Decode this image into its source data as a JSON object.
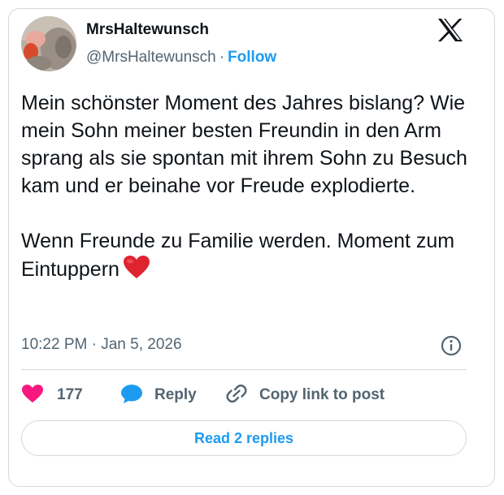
{
  "author": {
    "display_name": "MrsHaltewunsch",
    "handle": "@MrsHaltewunsch",
    "separator": "·",
    "follow_label": "Follow"
  },
  "tweet": {
    "paragraphs": [
      "Mein schönster Moment des Jahres bislang? Wie mein Sohn meiner besten Freundin in den Arm sprang als sie spontan mit ihrem Sohn zu Besuch kam und er beinahe vor Freude explodierte.",
      "Wenn Freunde zu Familie werden. Moment zum Eintuppern"
    ],
    "emoji": "red-heart-emoji",
    "timestamp": "10:22 PM · Jan 5, 2026"
  },
  "actions": {
    "like_count": "177",
    "reply_label": "Reply",
    "copy_link_label": "Copy link to post"
  },
  "footer": {
    "read_replies_label": "Read 2 replies"
  },
  "colors": {
    "accent": "#1d9bf0",
    "like": "#f91880",
    "secondary_text": "#536471",
    "border": "#cfd9de"
  },
  "icons": [
    "x-logo-icon",
    "info-icon",
    "heart-icon",
    "reply-bubble-icon",
    "link-icon"
  ]
}
